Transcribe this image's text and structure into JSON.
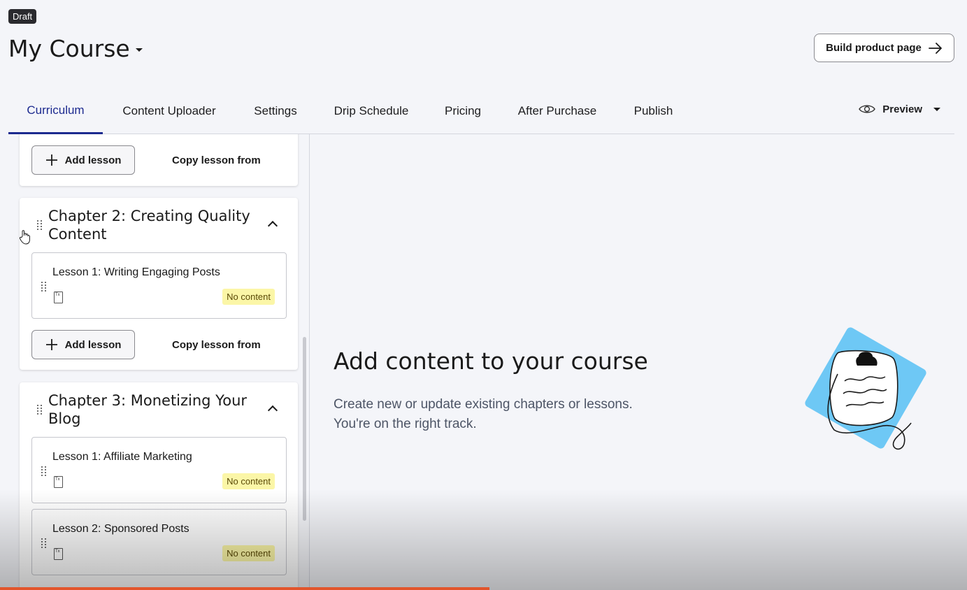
{
  "header": {
    "status_badge": "Draft",
    "course_title": "My Course",
    "build_button": "Build product page"
  },
  "tabs": [
    {
      "label": "Curriculum",
      "active": true
    },
    {
      "label": "Content Uploader"
    },
    {
      "label": "Settings"
    },
    {
      "label": "Drip Schedule"
    },
    {
      "label": "Pricing"
    },
    {
      "label": "After Purchase"
    },
    {
      "label": "Publish"
    }
  ],
  "preview": {
    "label": "Preview"
  },
  "curriculum": {
    "add_lesson_label": "Add lesson",
    "copy_lesson_label": "Copy lesson from",
    "chapters": [
      {
        "title": "Chapter 2: Creating Quality Content",
        "lessons": [
          {
            "title": "Lesson 1: Writing Engaging Posts",
            "status": "No content"
          }
        ]
      },
      {
        "title": "Chapter 3: Monetizing Your Blog",
        "lessons": [
          {
            "title": "Lesson 1: Affiliate Marketing",
            "status": "No content"
          },
          {
            "title": "Lesson 2: Sponsored Posts",
            "status": "No content"
          }
        ]
      }
    ]
  },
  "main": {
    "heading": "Add content to your course",
    "subtext": "Create new or update existing chapters or lessons. You're on the right track."
  },
  "colors": {
    "accent": "#1c2a8f",
    "background": "#f4f5f9",
    "badge_yellow": "#fbf6a7",
    "illustration_blue": "#6ec8f5"
  }
}
